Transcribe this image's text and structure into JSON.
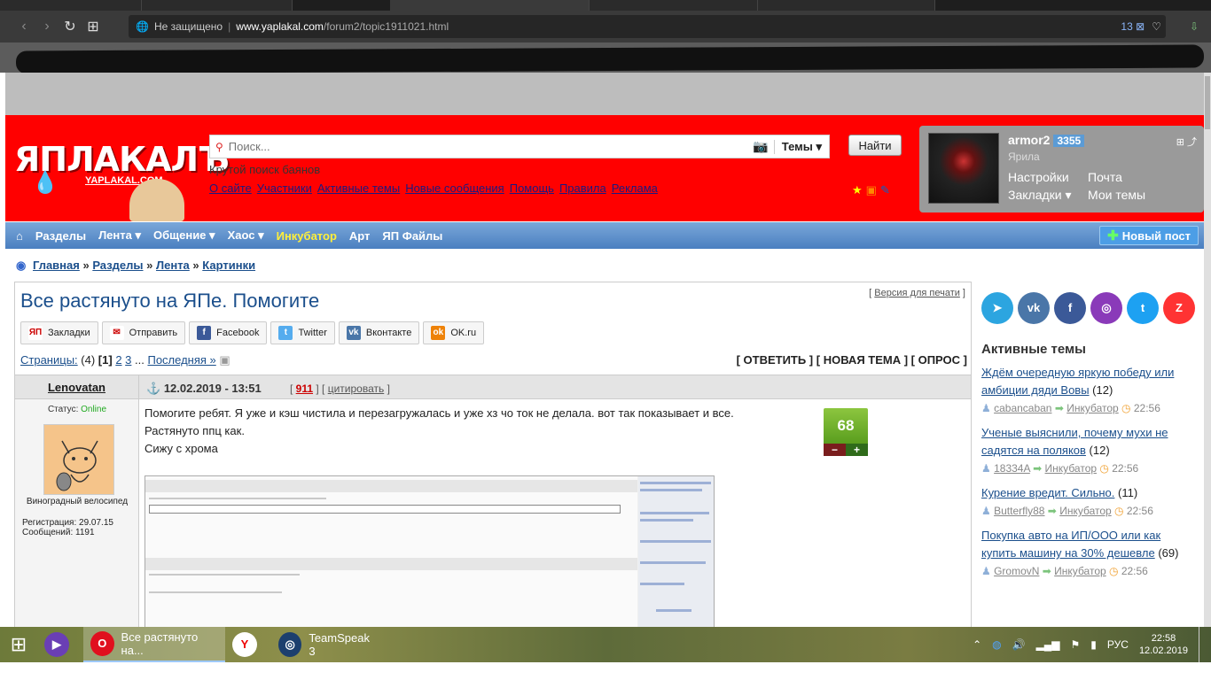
{
  "browser": {
    "security_label": "Не защищено",
    "url_host": "www.yaplakal.com",
    "url_path": "/forum2/topic1911021.html",
    "badge_count": "13"
  },
  "header": {
    "search_placeholder": "Поиск...",
    "search_scope": "Темы",
    "search_button": "Найти",
    "tagline": "Крутой поиск баянов",
    "logo_main": "ЯПЛАКАЛЪ",
    "logo_sub": "YAPLAKAL.COM",
    "top_links": [
      "О сайте",
      "Участники",
      "Активные темы",
      "Новые сообщения",
      "Помощь",
      "Правила",
      "Реклама"
    ]
  },
  "user": {
    "name": "armor2",
    "reputation": "3355",
    "rank": "Ярила",
    "links": [
      "Настройки",
      "Почта",
      "Закладки ▾",
      "Мои темы"
    ]
  },
  "menu": {
    "items": [
      "Разделы",
      "Лента ▾",
      "Общение ▾",
      "Хаос ▾",
      "Инкубатор",
      "Арт",
      "ЯП Файлы"
    ],
    "new_post": "Новый пост"
  },
  "breadcrumbs": [
    "Главная",
    "Разделы",
    "Лента",
    "Картинки"
  ],
  "topic": {
    "title": "Все растянуто на ЯПе. Помогите",
    "print_version": "Версия для печати",
    "share_buttons": [
      {
        "label": "Закладки",
        "icon": "ЯП",
        "color": "#fff"
      },
      {
        "label": "Отправить",
        "icon": "✉",
        "color": "#fff"
      },
      {
        "label": "Facebook",
        "icon": "f",
        "color": "#3b5998"
      },
      {
        "label": "Twitter",
        "icon": "t",
        "color": "#55acee"
      },
      {
        "label": "Вконтакте",
        "icon": "vk",
        "color": "#4a76a8"
      },
      {
        "label": "OK.ru",
        "icon": "ok",
        "color": "#ee8208"
      }
    ],
    "pages_label": "Страницы:",
    "pages_total": "(4)",
    "pages_current": "[1]",
    "pages_links": [
      "2",
      "3"
    ],
    "pages_last": "Последняя »",
    "actions": "[ ОТВЕТИТЬ ] [ НОВАЯ ТЕМА ] [ ОПРОС ]"
  },
  "post": {
    "author": "Lenovatan",
    "date": "12.02.2019 - 13:51",
    "number": "911",
    "quote": "цитировать",
    "status_label": "Статус:",
    "status_value": "Online",
    "user_title": "Виноградный велосипед",
    "registered": "Регистрация: 29.07.15",
    "messages": "Сообщений: 1191",
    "lines": [
      "Помогите ребят. Я уже и кэш чистила и перезагружалась и уже хз чо ток не делала. вот так показывает и все.",
      "Растянуто ппц как.",
      "Сижу с хрома"
    ],
    "rating": "68"
  },
  "sidebar": {
    "social": [
      {
        "name": "telegram-icon",
        "glyph": "➤",
        "color": "#2ca5e0"
      },
      {
        "name": "vk-icon",
        "glyph": "vk",
        "color": "#4a76a8"
      },
      {
        "name": "facebook-icon",
        "glyph": "f",
        "color": "#3b5998"
      },
      {
        "name": "instagram-icon",
        "glyph": "◎",
        "color": "#8a3ab9"
      },
      {
        "name": "twitter-icon",
        "glyph": "t",
        "color": "#1da1f2"
      },
      {
        "name": "zen-icon",
        "glyph": "Z",
        "color": "#ff3333"
      }
    ],
    "active_title": "Активные темы",
    "topics": [
      {
        "title": "Ждём очередную яркую победу или амбиции дяди Вовы",
        "count": "(12)",
        "author": "cabancaban",
        "section": "Инкубатор",
        "time": "22:56"
      },
      {
        "title": "Ученые выяснили, почему мухи не садятся на поляков",
        "count": "(12)",
        "author": "18334A",
        "section": "Инкубатор",
        "time": "22:56"
      },
      {
        "title": "Курение вредит. Сильно.",
        "count": "(11)",
        "author": "Butterfly88",
        "section": "Инкубатор",
        "time": "22:56"
      },
      {
        "title": "Покупка авто на ИП/ООО или как купить машину на 30% дешевле",
        "count": "(69)",
        "author": "GromovN",
        "section": "Инкубатор",
        "time": "22:56"
      }
    ]
  },
  "taskbar": {
    "apps": [
      {
        "label": "",
        "icon": "▶",
        "color": "#6a3fb5"
      },
      {
        "label": "Все растянуто на...",
        "icon": "O",
        "color": "#e0101e",
        "active": true
      },
      {
        "label": "",
        "icon": "Y",
        "color": "#ffffff"
      },
      {
        "label": "TeamSpeak 3",
        "icon": "◎",
        "color": "#1c3f6e"
      }
    ],
    "lang": "РУС",
    "time": "22:58",
    "date": "12.02.2019"
  }
}
